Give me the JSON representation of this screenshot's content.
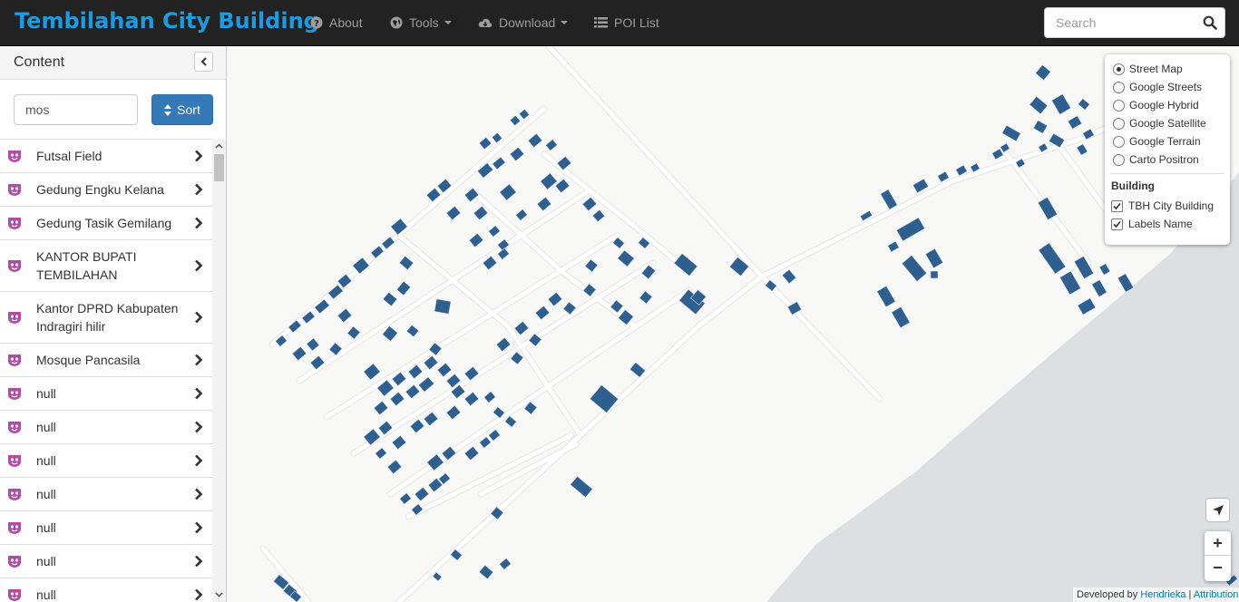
{
  "navbar": {
    "brand": "Tembilahan City Building",
    "items": [
      {
        "label": "About",
        "icon": "question-circle-icon"
      },
      {
        "label": "Tools",
        "icon": "globe-icon",
        "dropdown": true
      },
      {
        "label": "Download",
        "icon": "cloud-download-icon",
        "dropdown": true
      },
      {
        "label": "POI List",
        "icon": "list-icon"
      }
    ],
    "search_placeholder": "Search"
  },
  "sidebar": {
    "title": "Content",
    "filter_value": "mos",
    "sort_label": "Sort",
    "items": [
      {
        "label": "Futsal Field"
      },
      {
        "label": "Gedung Engku Kelana"
      },
      {
        "label": "Gedung Tasik Gemilang"
      },
      {
        "label": "KANTOR BUPATI TEMBILAHAN"
      },
      {
        "label": "Kantor DPRD Kabupaten Indragiri hilir"
      },
      {
        "label": "Mosque Pancasila"
      },
      {
        "label": "null"
      },
      {
        "label": "null"
      },
      {
        "label": "null"
      },
      {
        "label": "null"
      },
      {
        "label": "null"
      },
      {
        "label": "null"
      },
      {
        "label": "null"
      }
    ]
  },
  "layers": {
    "basemaps": [
      {
        "label": "Street Map",
        "selected": true
      },
      {
        "label": "Google Streets",
        "selected": false
      },
      {
        "label": "Google Hybrid",
        "selected": false
      },
      {
        "label": "Google Satellite",
        "selected": false
      },
      {
        "label": "Google Terrain",
        "selected": false
      },
      {
        "label": "Carto Positron",
        "selected": false
      }
    ],
    "group_title": "Building",
    "overlays": [
      {
        "label": "TBH City Building",
        "checked": true
      },
      {
        "label": "Labels Name",
        "checked": true
      }
    ]
  },
  "map": {
    "zoom_in": "+",
    "zoom_out": "−",
    "attribution_prefix": "Developed by",
    "attribution_author": "Hendrieka",
    "attribution_sep": "|",
    "attribution_link": "Attribution",
    "colors": {
      "building": "#2e5f8e",
      "water": "#dde0e3",
      "road": "#ffffff",
      "land": "#f8f8f6"
    }
  }
}
